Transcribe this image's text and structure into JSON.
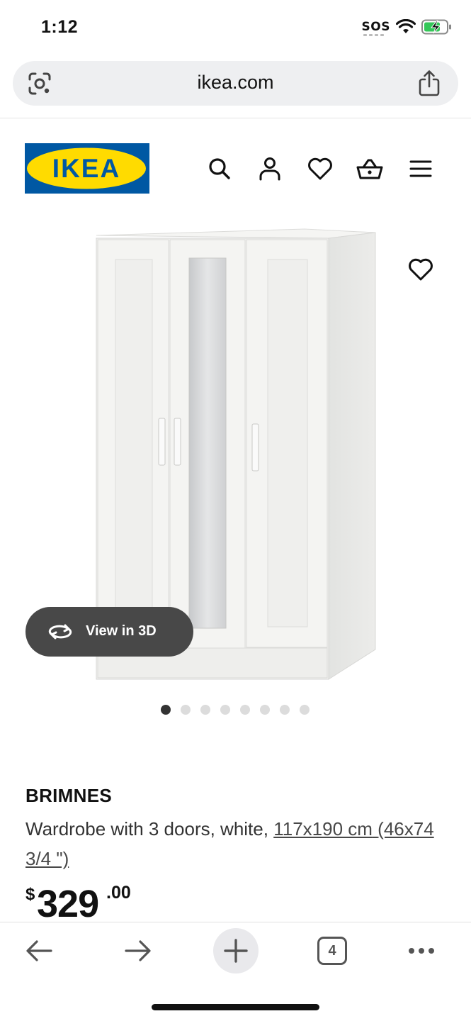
{
  "status_bar": {
    "time": "1:12",
    "sos": "SOS",
    "icons": [
      "wifi-icon",
      "battery-charging-icon"
    ]
  },
  "browser": {
    "url": "ikea.com",
    "left_icon": "lens-icon",
    "right_icon": "share-icon"
  },
  "header": {
    "logo_text": "IKEA",
    "icons": [
      "search-icon",
      "user-icon",
      "heart-icon",
      "basket-icon",
      "menu-icon"
    ],
    "colors": {
      "logo_blue": "#0058a3",
      "logo_yellow": "#ffdb00"
    }
  },
  "gallery": {
    "view_3d_label": "View in 3D",
    "image_count": 8,
    "active_index": 0
  },
  "product": {
    "name": "BRIMNES",
    "description": "Wardrobe with 3 doors, white,",
    "dimensions_metric": "117x190 cm",
    "dimensions_imperial": "(46x74 3/4 \")",
    "price_currency": "$",
    "price_whole": "329",
    "price_decimal": ".00"
  },
  "bottom_bar": {
    "icons": [
      "back-icon",
      "forward-icon",
      "new-tab-icon",
      "tabs-icon",
      "more-icon"
    ],
    "tab_count": "4"
  }
}
